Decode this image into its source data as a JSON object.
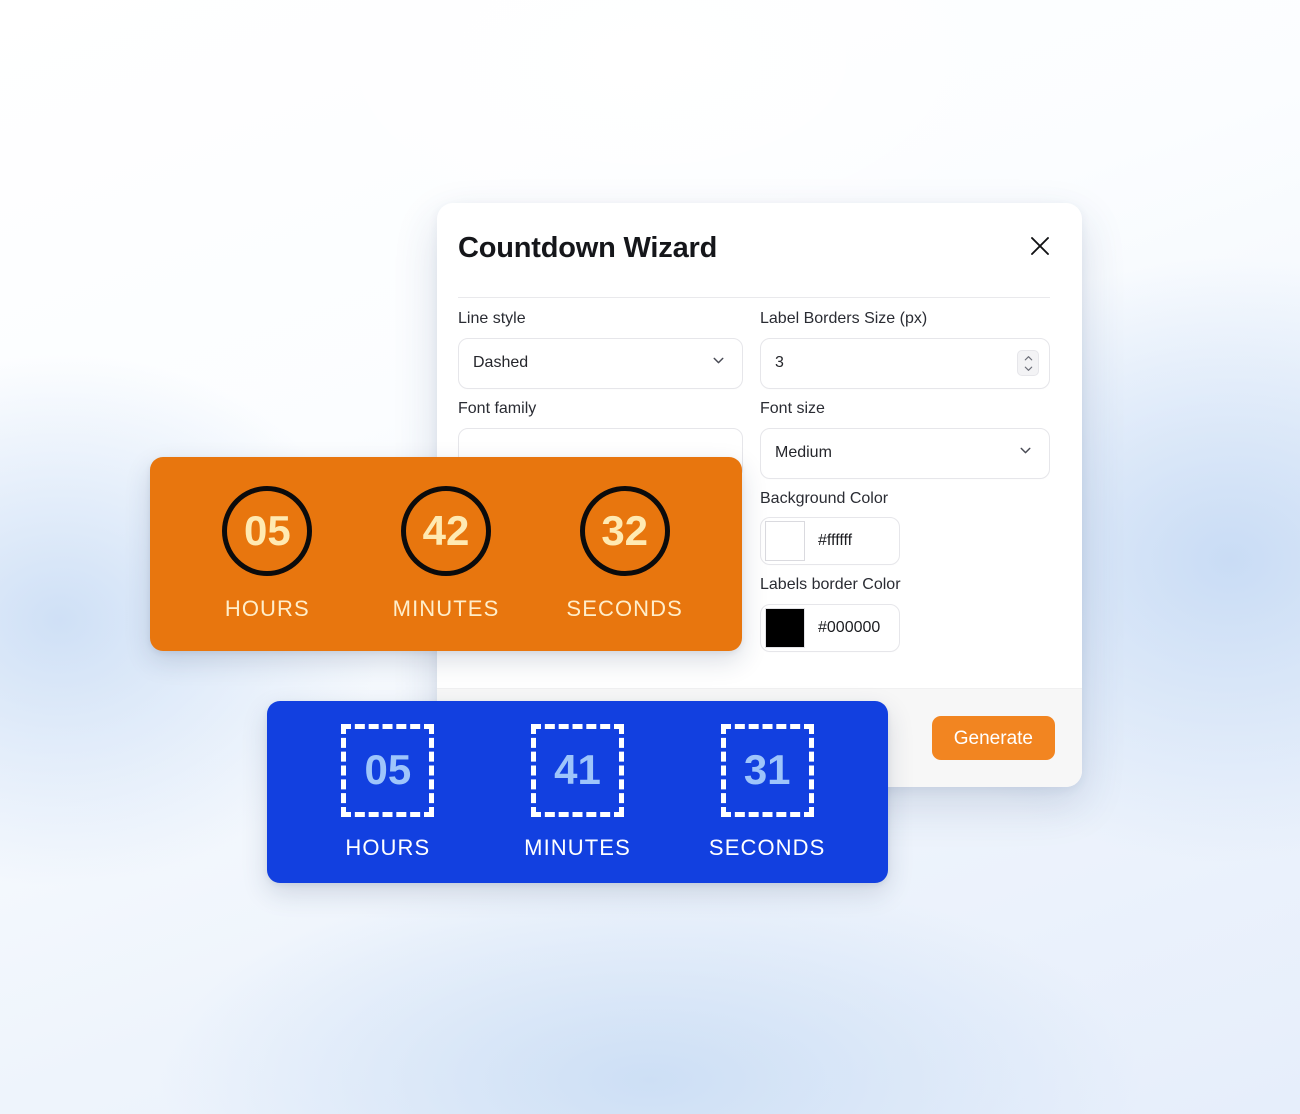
{
  "dialog": {
    "title": "Countdown Wizard",
    "close_icon": "close-icon",
    "fields": {
      "line_style": {
        "label": "Line style",
        "value": "Dashed",
        "icon": "chevron-down-icon"
      },
      "label_borders_size": {
        "label": "Label Borders Size (px)",
        "value": "3",
        "icon": "number-spinner-icon"
      },
      "font_family": {
        "label": "Font family",
        "value": ""
      },
      "font_size": {
        "label": "Font size",
        "value": "Medium",
        "icon": "chevron-down-icon"
      },
      "background_color": {
        "label": "Background Color",
        "value": "#ffffff",
        "swatch": "#ffffff"
      },
      "labels_border_color": {
        "label": "Labels border Color",
        "value": "#000000",
        "swatch": "#000000"
      },
      "occluded_color": {
        "swatch": "#d9534f"
      }
    },
    "footer": {
      "generate_label": "Generate",
      "generate_color": "#f28521"
    }
  },
  "preview_orange": {
    "background": "#e8760e",
    "digit_color": "#ffeab2",
    "border_color": "#000000",
    "units": [
      {
        "value": "05",
        "label": "HOURS"
      },
      {
        "value": "42",
        "label": "MINUTES"
      },
      {
        "value": "32",
        "label": "SECONDS"
      }
    ]
  },
  "preview_blue": {
    "background": "#1240e0",
    "digit_color": "#9ec5fb",
    "border_color": "#ffffff",
    "units": [
      {
        "value": "05",
        "label": "HOURS"
      },
      {
        "value": "41",
        "label": "MINUTES"
      },
      {
        "value": "31",
        "label": "SECONDS"
      }
    ]
  }
}
